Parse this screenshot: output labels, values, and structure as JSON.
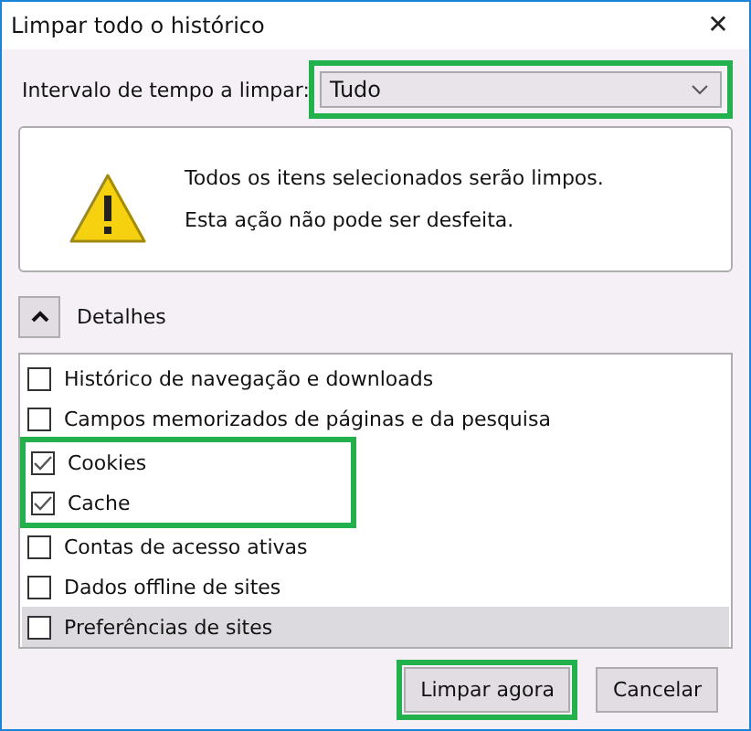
{
  "window": {
    "title": "Limpar todo o histórico",
    "close": "✕"
  },
  "time_range": {
    "label": "Intervalo de tempo a limpar:",
    "value": "Tudo",
    "highlighted": true
  },
  "warning": {
    "lines": [
      "Todos os itens selecionados serão limpos.",
      "Esta ação não pode ser desfeita."
    ]
  },
  "details": {
    "label": "Detalhes",
    "expanded": true
  },
  "items": [
    {
      "label": "Histórico de navegação e downloads",
      "checked": false,
      "selected": false,
      "highlighted": false
    },
    {
      "label": "Campos memorizados de páginas e da pesquisa",
      "checked": false,
      "selected": false,
      "highlighted": false
    },
    {
      "label": "Cookies",
      "checked": true,
      "selected": false,
      "highlighted": true
    },
    {
      "label": "Cache",
      "checked": true,
      "selected": false,
      "highlighted": true
    },
    {
      "label": "Contas de acesso ativas",
      "checked": false,
      "selected": false,
      "highlighted": false
    },
    {
      "label": "Dados offline de sites",
      "checked": false,
      "selected": false,
      "highlighted": false
    },
    {
      "label": "Preferências de sites",
      "checked": false,
      "selected": true,
      "highlighted": false
    }
  ],
  "buttons": [
    {
      "label": "Limpar agora",
      "highlighted": true
    },
    {
      "label": "Cancelar",
      "highlighted": false
    }
  ]
}
